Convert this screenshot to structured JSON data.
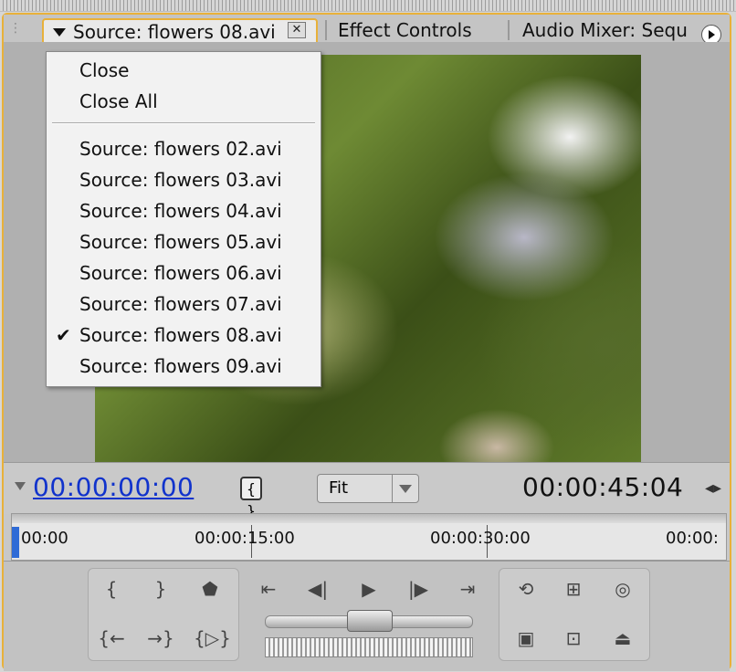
{
  "tabs": {
    "active": "Source: flowers 08.avi",
    "close": "✕",
    "second": "Effect Controls",
    "third": "Audio Mixer: Seque"
  },
  "menu": {
    "items": [
      {
        "label": "Close"
      },
      {
        "label": "Close All"
      },
      {
        "label": "Source: flowers 02.avi"
      },
      {
        "label": "Source: flowers 03.avi"
      },
      {
        "label": "Source: flowers 04.avi"
      },
      {
        "label": "Source: flowers 05.avi"
      },
      {
        "label": "Source: flowers 06.avi"
      },
      {
        "label": "Source: flowers 07.avi"
      },
      {
        "label": "Source: flowers 08.avi"
      },
      {
        "label": "Source: flowers 09.avi"
      }
    ],
    "checked_index": 8
  },
  "timecode": {
    "current": "00:00:00:00",
    "duration": "00:00:45:04"
  },
  "zoom": {
    "label": "Fit"
  },
  "ruler": {
    "labels": [
      "00:00",
      "00:00:15:00",
      "00:00:30:00",
      "00:00:"
    ]
  },
  "icons": {
    "tab_menu": "triangle-down-icon",
    "flyout": "play-circle-icon",
    "checkmark": "check-icon"
  },
  "colors": {
    "accent": "#e8b13a",
    "timecode_blue": "#1133cc"
  }
}
